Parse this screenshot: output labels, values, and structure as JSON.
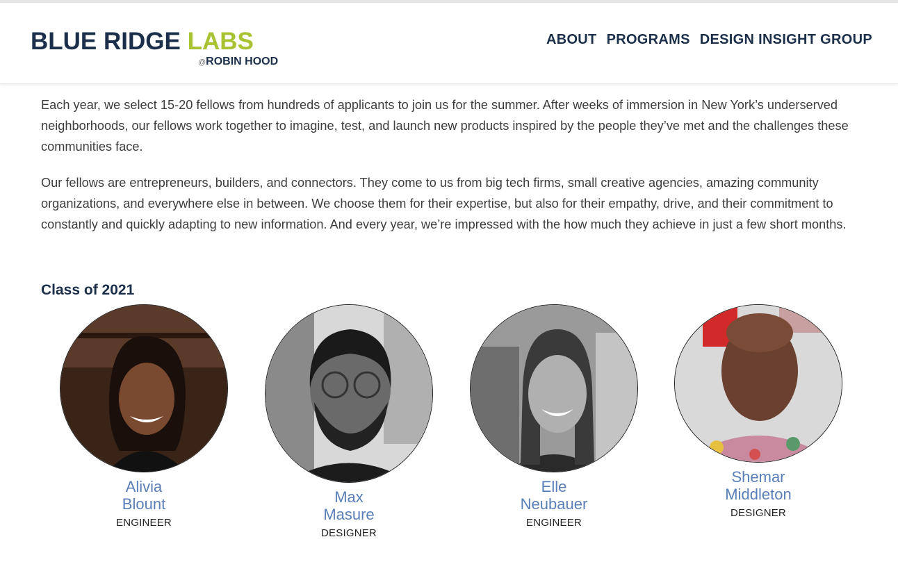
{
  "brand": {
    "logo_main_a": "BLUE RIDGE ",
    "logo_main_b": "LABS",
    "logo_at": "@",
    "logo_sub": "ROBIN HOOD",
    "colors": {
      "navy": "#1c2f4a",
      "lime": "#a7c332",
      "name_blue": "#5a7fb8"
    }
  },
  "nav": [
    "ABOUT",
    "PROGRAMS",
    "DESIGN INSIGHT GROUP"
  ],
  "intro": [
    "Each year, we select 15-20 fellows from hundreds of applicants to join us for the summer. After weeks of immersion in New York’s underserved neighborhoods, our fellows work together to imagine, test, and launch new products inspired by the people they’ve met and the challenges these communities face.",
    "Our fellows are entrepreneurs, builders, and connectors. They come to us from big tech firms, small creative agencies, amazing community organizations, and everywhere else in between. We choose them for their expertise, but also for their empathy, drive, and their commitment to constantly and quickly adapting to new information. And every year, we’re impressed with the how much they achieve in just a few short months."
  ],
  "class_title": "Class of 2021",
  "fellows": [
    {
      "first": "Alivia",
      "last": "Blount",
      "role": "ENGINEER",
      "photo_icon": "person-photo"
    },
    {
      "first": "Max",
      "last": "Masure",
      "role": "DESIGNER",
      "photo_icon": "person-photo"
    },
    {
      "first": "Elle",
      "last": "Neubauer",
      "role": "ENGINEER",
      "photo_icon": "person-photo"
    },
    {
      "first": "Shemar",
      "last": "Middleton",
      "role": "DESIGNER",
      "photo_icon": "person-photo"
    }
  ]
}
